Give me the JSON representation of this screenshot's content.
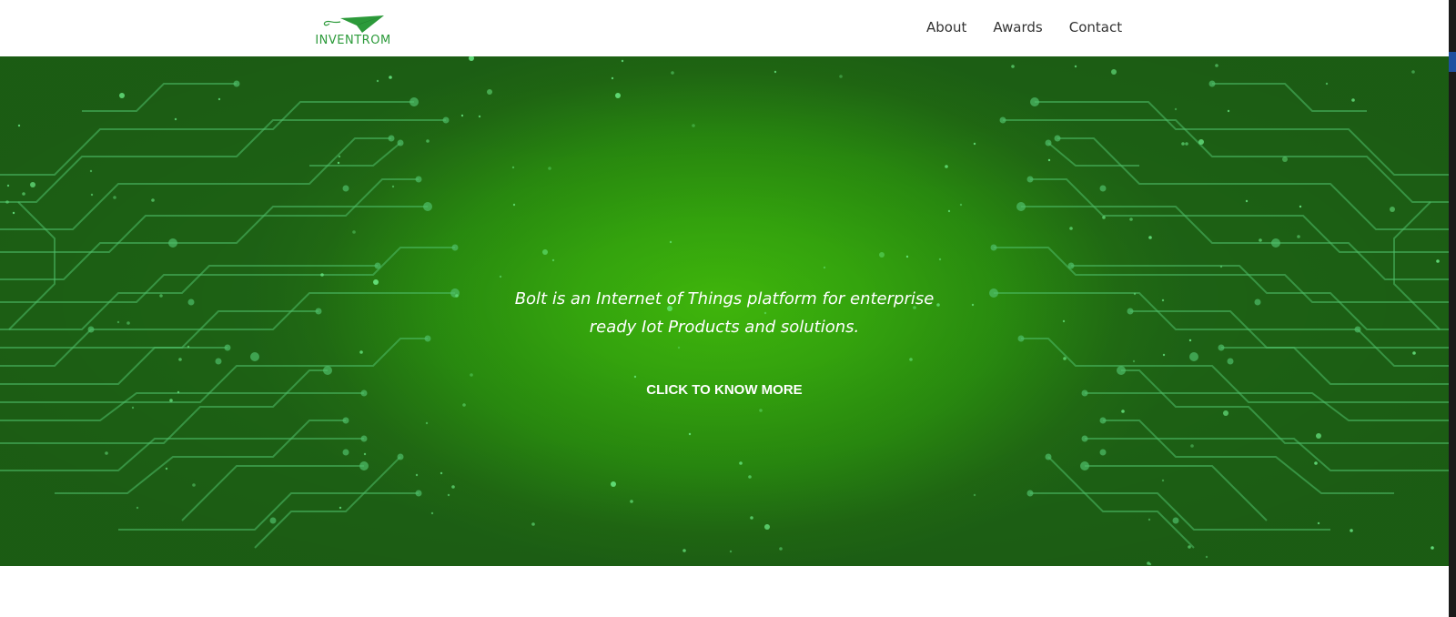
{
  "header": {
    "logo_text": "INVENTROM",
    "nav": [
      {
        "label": "About"
      },
      {
        "label": "Awards"
      },
      {
        "label": "Contact"
      }
    ]
  },
  "hero": {
    "tagline_line1": "Bolt is an Internet of Things platform for enterprise",
    "tagline_line2": "ready Iot Products and solutions.",
    "cta_label": "CLICK TO KNOW MORE"
  },
  "colors": {
    "brand_green": "#2c9a3a",
    "hero_center": "#3fb50c",
    "hero_edge": "#1f6816",
    "circuit_line": "#4fbf6a"
  },
  "icons": {
    "logo_mark": "paper-plane-icon"
  }
}
